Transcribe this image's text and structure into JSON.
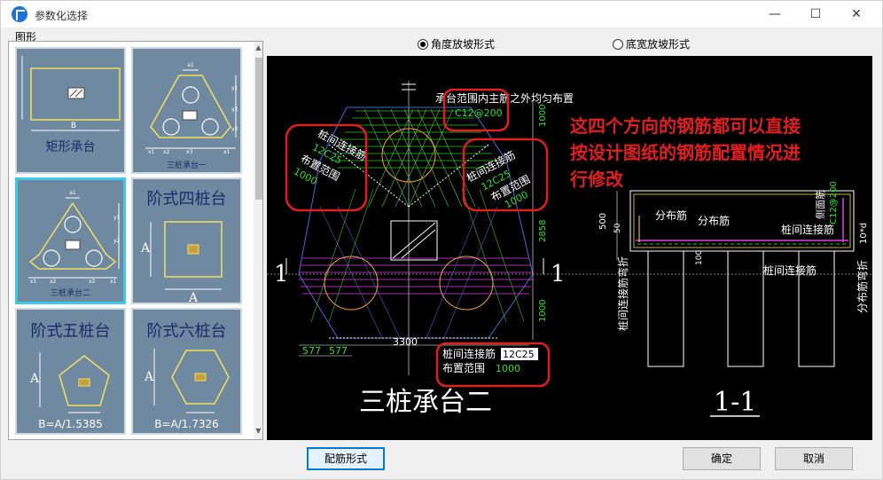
{
  "window": {
    "title": "参数化选择",
    "minimize": "—",
    "maximize": "☐",
    "close": "✕"
  },
  "left": {
    "group_label": "图形",
    "thumbs": [
      {
        "label": "矩形承台",
        "dim": "B"
      },
      {
        "label": "三桩承台一",
        "dims": [
          "a1",
          "x1",
          "x2",
          "x3",
          "x1",
          "y1",
          "y2",
          "y3"
        ]
      },
      {
        "label": "三桩承台二",
        "dims": [
          "a1",
          "x1",
          "x2",
          "x2",
          "x1",
          "y1",
          "y2"
        ]
      },
      {
        "label": "阶式四桩台",
        "dim_a": "A",
        "dim_b": "A"
      },
      {
        "label": "阶式五桩台",
        "dim_a": "A",
        "formula": "B=A/1.5385"
      },
      {
        "label": "阶式六桩台",
        "dim_a": "A",
        "formula": "B=A/1.7326"
      }
    ]
  },
  "radios": [
    {
      "label": "角度放坡形式",
      "checked": true
    },
    {
      "label": "底宽放坡形式",
      "checked": false
    }
  ],
  "drawing": {
    "title": "三桩承台二",
    "top_note": "承台范围内主筋之外均匀布置",
    "top_rebar": "C12@200",
    "left_label_1": "桩间连接筋",
    "left_rebar": "12C25",
    "left_label_2": "布置范围",
    "left_range": "1000",
    "right_label_1": "桩间连接筋",
    "right_rebar": "12C25",
    "right_label_2": "布置范围",
    "right_range": "1000",
    "bottom_label_1": "桩间连接筋",
    "bottom_rebar": "12C25",
    "bottom_label_2": "布置范围",
    "bottom_range": "1000",
    "dim_1000_top": "1000",
    "dim_2858": "2858",
    "dim_1000_bottom": "1000",
    "dim_3300": "3300",
    "dim_577_a": "577",
    "dim_577_b": "577",
    "section_mark_left": "1",
    "section_mark_right": "1",
    "annotation_line1": "这四个方向的钢筋都可以直接",
    "annotation_line2": "按设计图纸的钢筋配置情况进",
    "annotation_line3": "行修改",
    "section_title": "1-1",
    "sec_dim_500": "500",
    "sec_dim_50": "50",
    "sec_dim_100": "100",
    "sec_fenbujin_1": "分布筋",
    "sec_fenbujin_2": "分布筋",
    "sec_cejin": "侧面筋",
    "sec_cejin_rebar": "C12@200",
    "sec_zhuangjian_1": "桩间连接筋",
    "sec_zhuangjian_2": "桩间连接筋",
    "sec_wanzhe_left": "桩间连接筋弯折",
    "sec_wanzhe_right": "分布筋弯折",
    "sec_10d": "10*d"
  },
  "buttons": {
    "rebar_form": "配筋形式",
    "ok": "确定",
    "cancel": "取消"
  }
}
